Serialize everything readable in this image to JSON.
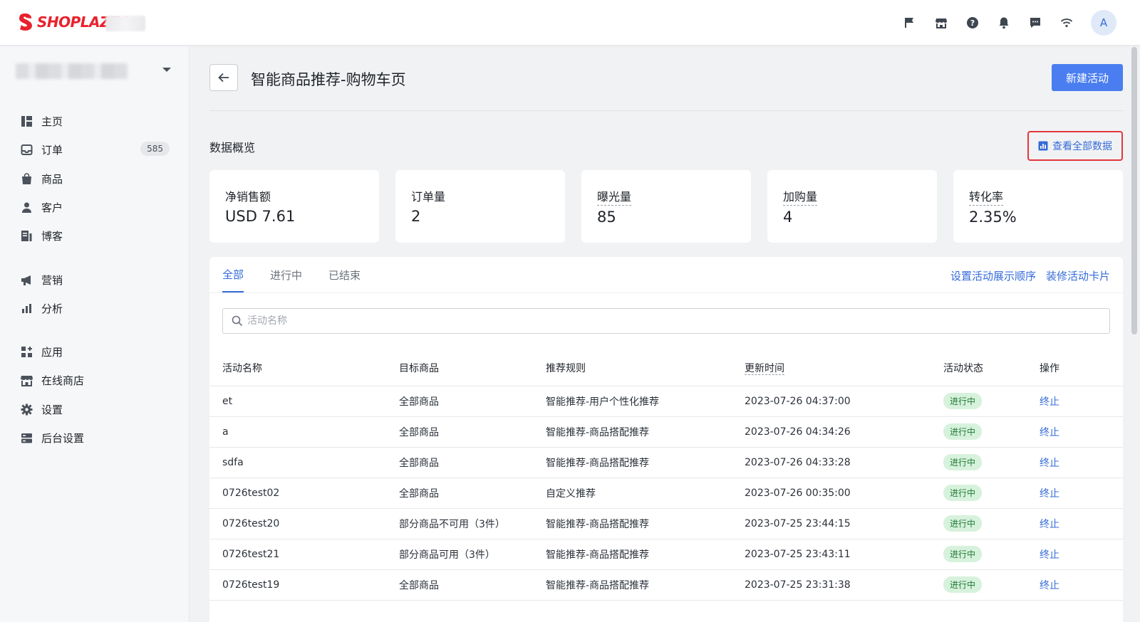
{
  "brand": {
    "logo_text": "SHOPLAZZA"
  },
  "topbar": {
    "icons": [
      "flag-icon",
      "store-icon",
      "help-icon",
      "bell-icon",
      "chat-icon",
      "wifi-icon"
    ],
    "avatar_initial": "A"
  },
  "sidebar": {
    "items": [
      {
        "label": "主页",
        "icon": "home-icon"
      },
      {
        "label": "订单",
        "icon": "inbox-icon",
        "badge": "585"
      },
      {
        "label": "商品",
        "icon": "bag-icon"
      },
      {
        "label": "客户",
        "icon": "user-icon"
      },
      {
        "label": "博客",
        "icon": "blog-icon"
      },
      {
        "label": "营销",
        "icon": "megaphone-icon"
      },
      {
        "label": "分析",
        "icon": "bar-chart-icon"
      },
      {
        "label": "应用",
        "icon": "apps-icon"
      },
      {
        "label": "在线商店",
        "icon": "storefront-icon"
      },
      {
        "label": "设置",
        "icon": "gear-icon"
      },
      {
        "label": "后台设置",
        "icon": "server-icon"
      }
    ]
  },
  "header": {
    "title": "智能商品推荐-购物车页",
    "new_button": "新建活动"
  },
  "overview": {
    "label": "数据概览",
    "view_all": "查看全部数据",
    "stats": [
      {
        "label": "净销售额",
        "value": "USD 7.61"
      },
      {
        "label": "订单量",
        "value": "2"
      },
      {
        "label": "曝光量",
        "value": "85"
      },
      {
        "label": "加购量",
        "value": "4"
      },
      {
        "label": "转化率",
        "value": "2.35%"
      }
    ]
  },
  "panel": {
    "tabs": [
      "全部",
      "进行中",
      "已结束"
    ],
    "links": [
      "设置活动展示顺序",
      "装修活动卡片"
    ],
    "search_placeholder": "活动名称",
    "columns": [
      "活动名称",
      "目标商品",
      "推荐规则",
      "更新时间",
      "活动状态",
      "操作"
    ],
    "rows": [
      {
        "name": "et",
        "target": "全部商品",
        "rule": "智能推荐-用户个性化推荐",
        "updated": "2023-07-26 04:37:00",
        "status": "进行中",
        "action": "终止"
      },
      {
        "name": "a",
        "target": "全部商品",
        "rule": "智能推荐-商品搭配推荐",
        "updated": "2023-07-26 04:34:26",
        "status": "进行中",
        "action": "终止"
      },
      {
        "name": "sdfa",
        "target": "全部商品",
        "rule": "智能推荐-商品搭配推荐",
        "updated": "2023-07-26 04:33:28",
        "status": "进行中",
        "action": "终止"
      },
      {
        "name": "0726test02",
        "target": "全部商品",
        "rule": "自定义推荐",
        "updated": "2023-07-26 00:35:00",
        "status": "进行中",
        "action": "终止"
      },
      {
        "name": "0726test20",
        "target": "部分商品不可用（3件）",
        "rule": "智能推荐-商品搭配推荐",
        "updated": "2023-07-25 23:44:15",
        "status": "进行中",
        "action": "终止"
      },
      {
        "name": "0726test21",
        "target": "部分商品可用（3件）",
        "rule": "智能推荐-商品搭配推荐",
        "updated": "2023-07-25 23:43:11",
        "status": "进行中",
        "action": "终止"
      },
      {
        "name": "0726test19",
        "target": "全部商品",
        "rule": "智能推荐-商品搭配推荐",
        "updated": "2023-07-25 23:31:38",
        "status": "进行中",
        "action": "终止"
      }
    ]
  }
}
